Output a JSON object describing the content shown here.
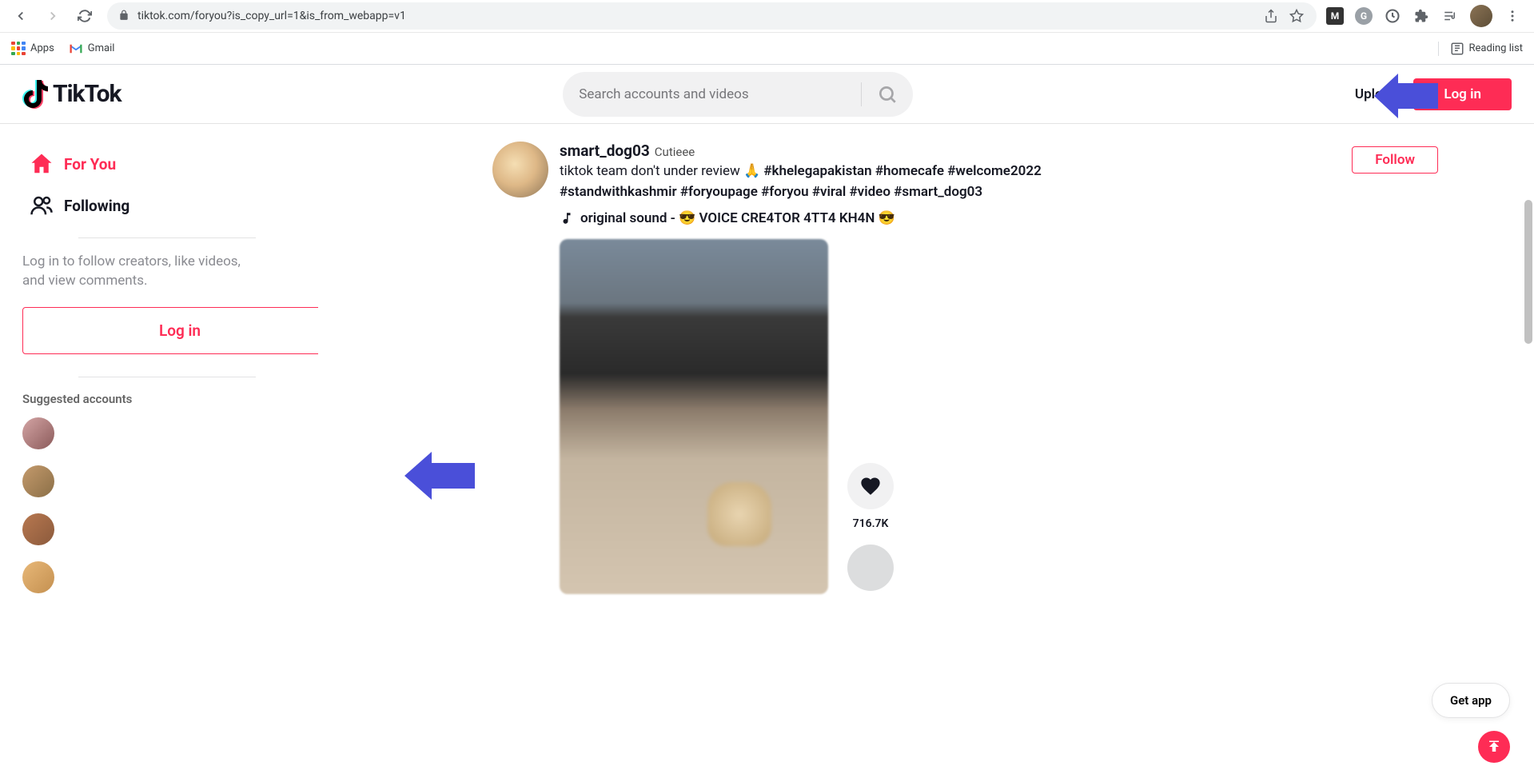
{
  "browser": {
    "url": "tiktok.com/foryou?is_copy_url=1&is_from_webapp=v1",
    "bookmarks": {
      "apps": "Apps",
      "gmail": "Gmail",
      "reading_list": "Reading list"
    }
  },
  "header": {
    "logo_text": "TikTok",
    "search_placeholder": "Search accounts and videos",
    "upload": "Upload",
    "login": "Log in"
  },
  "sidebar": {
    "nav": {
      "for_you": "For You",
      "following": "Following"
    },
    "login_prompt": "Log in to follow creators, like videos, and view comments.",
    "login_button": "Log in",
    "suggested_title": "Suggested accounts"
  },
  "post": {
    "username": "smart_dog03",
    "nickname": "Cutieee",
    "caption_text": "tiktok team don't under review 🙏 ",
    "hashtags": "#khelegapakistan #homecafe #welcome2022 #standwithkashmir #foryoupage #foryou #viral #video #smart_dog03",
    "sound": "original sound - 😎 VOICE CRE4TOR 4TT4 KH4N 😎",
    "follow": "Follow",
    "like_count": "716.7K"
  },
  "floating": {
    "get_app": "Get app"
  }
}
